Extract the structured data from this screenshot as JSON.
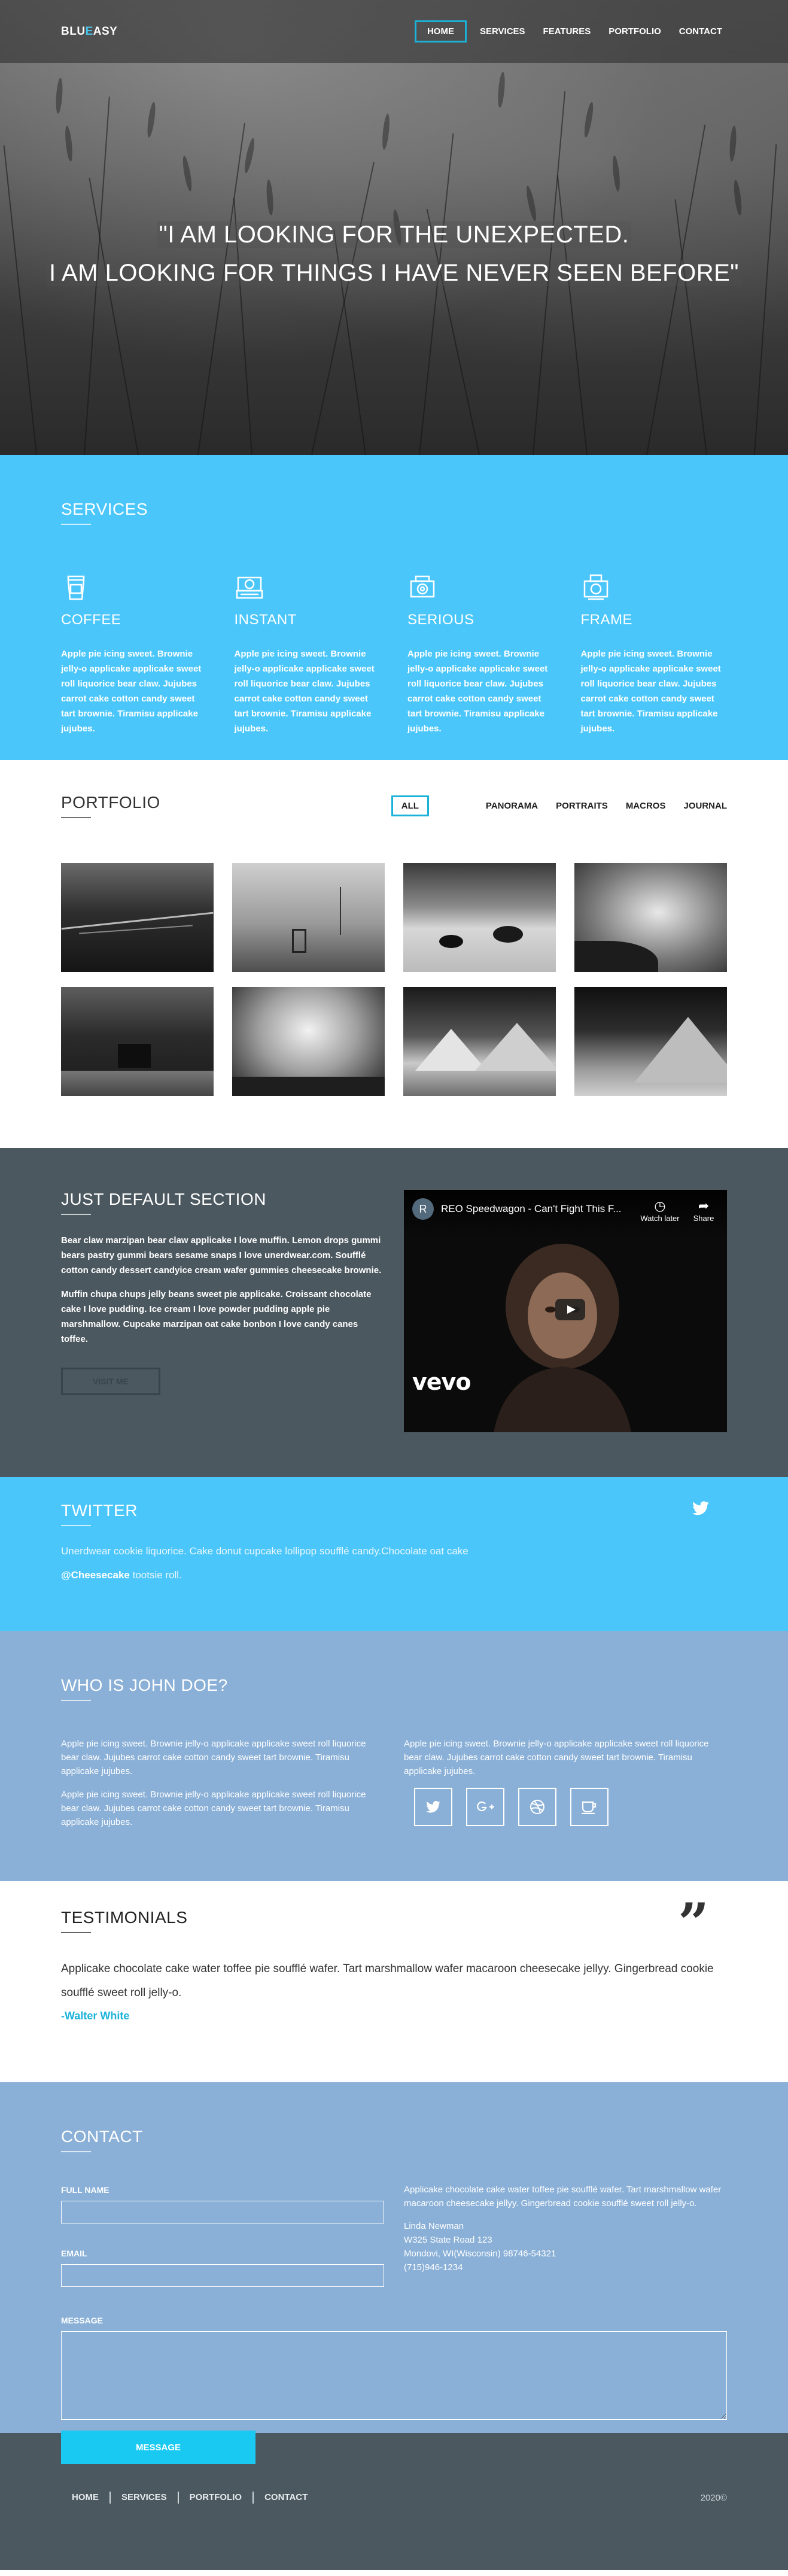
{
  "header": {
    "logo_part1": "BLU",
    "logo_accent": "E",
    "logo_part2": "ASY",
    "nav": [
      {
        "label": "HOME"
      },
      {
        "label": "SERVICES"
      },
      {
        "label": "FEATURES"
      },
      {
        "label": "PORTFOLIO"
      },
      {
        "label": "CONTACT"
      }
    ]
  },
  "hero": {
    "line1": "\"I AM LOOKING FOR THE UNEXPECTED.",
    "line2": "I AM LOOKING FOR THINGS I HAVE NEVER SEEN BEFORE\""
  },
  "services": {
    "title": "SERVICES",
    "items": [
      {
        "icon": "coffee-cup-icon",
        "name": "COFFEE",
        "text": "Apple pie icing sweet. Brownie jelly-o applicake applicake sweet roll liquorice bear claw. Jujubes carrot cake cotton candy sweet tart brownie. Tiramisu applicake jujubes."
      },
      {
        "icon": "camera-icon",
        "name": "INSTANT",
        "text": "Apple pie icing sweet. Brownie jelly-o applicake applicake sweet roll liquorice bear claw. Jujubes carrot cake cotton candy sweet tart brownie. Tiramisu applicake jujubes."
      },
      {
        "icon": "camera-icon",
        "name": "SERIOUS",
        "text": "Apple pie icing sweet. Brownie jelly-o applicake applicake sweet roll liquorice bear claw. Jujubes carrot cake cotton candy sweet tart brownie. Tiramisu applicake jujubes."
      },
      {
        "icon": "camera-icon",
        "name": "FRAME",
        "text": "Apple pie icing sweet. Brownie jelly-o applicake applicake sweet roll liquorice bear claw. Jujubes carrot cake cotton candy sweet tart brownie. Tiramisu applicake jujubes."
      }
    ]
  },
  "portfolio": {
    "title": "PORTFOLIO",
    "filters": [
      "ALL",
      "PANORAMA",
      "PORTRAITS",
      "MACROS",
      "JOURNAL"
    ]
  },
  "default_section": {
    "title": "JUST DEFAULT SECTION",
    "p1": "Bear claw marzipan bear claw applicake I love muffin. Lemon drops gummi bears pastry gummi bears sesame snaps I love unerdwear.com. Soufflé cotton candy dessert candyice cream wafer gummies cheesecake brownie.",
    "p2": "Muffin chupa chups jelly beans sweet pie applicake. Croissant chocolate cake I love pudding. Ice cream I love powder pudding apple pie marshmallow. Cupcake marzipan oat cake bonbon I love candy canes toffee.",
    "button": "VISIT ME",
    "video": {
      "avatar_letter": "R",
      "title": "REO Speedwagon - Can't Fight This F...",
      "watch_later": "Watch later",
      "share": "Share",
      "brand": "vevo"
    }
  },
  "twitter": {
    "title": "TWITTER",
    "line1": "Unerdwear cookie liquorice. Cake donut cupcake lollipop soufflé candy.Chocolate oat cake",
    "handle": "@Cheesecake",
    "line2_rest": " tootsie roll."
  },
  "whois": {
    "title": "WHO IS JOHN DOE?",
    "left_p1": "Apple pie icing sweet. Brownie jelly-o applicake applicake sweet roll liquorice bear claw. Jujubes carrot cake cotton candy sweet tart brownie. Tiramisu applicake jujubes.",
    "left_p2": "Apple pie icing sweet. Brownie jelly-o applicake applicake sweet roll liquorice bear claw. Jujubes carrot cake cotton candy sweet tart brownie. Tiramisu applicake jujubes.",
    "right_p1": "Apple pie icing sweet. Brownie jelly-o applicake applicake sweet roll liquorice bear claw. Jujubes carrot cake cotton candy sweet tart brownie. Tiramisu applicake jujubes.",
    "social": [
      "twitter-icon",
      "google-plus-icon",
      "dribbble-icon",
      "coffee-cup-icon"
    ]
  },
  "testimonials": {
    "title": "TESTIMONIALS",
    "quote": "Applicake chocolate cake water toffee pie soufflé wafer. Tart marshmallow wafer macaroon cheesecake jellyy. Gingerbread cookie soufflé sweet roll jelly-o.",
    "author": "-Walter White"
  },
  "contact": {
    "title": "CONTACT",
    "label_name": "FULL NAME",
    "label_email": "EMAIL",
    "label_message": "MESSAGE",
    "button": "MESSAGE",
    "blurb": "Applicake chocolate cake water toffee pie soufflé wafer. Tart marshmallow wafer macaroon cheesecake jellyy. Gingerbread cookie soufflé sweet roll jelly-o.",
    "address": [
      "Linda Newman",
      "W325 State Road 123",
      "Mondovi, WI(Wisconsin) 98746-54321",
      "(715)946-1234"
    ]
  },
  "footer": {
    "nav": [
      "HOME",
      "SERVICES",
      "PORTFOLIO",
      "CONTACT"
    ],
    "copyright": "2020©"
  },
  "colors": {
    "accent": "#1ab2d9",
    "services_bg": "#4bc6fa",
    "slate_bg": "#4c5860",
    "blue_gray_bg": "#8ab0d7"
  }
}
